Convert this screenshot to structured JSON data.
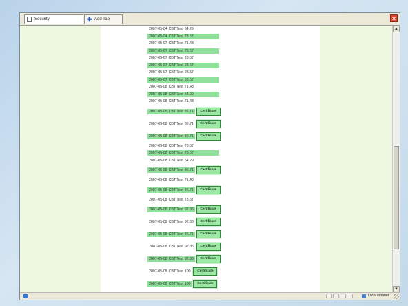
{
  "tabs": {
    "first_label": "Security",
    "add_label": "Add Tab"
  },
  "rows": [
    {
      "date": "2007-05-04",
      "test": "CBT Test",
      "score": "64.29",
      "highlight": false,
      "bar": false,
      "certificate": false
    },
    {
      "date": "2007-05-04",
      "test": "CBT Test",
      "score": "78.57",
      "highlight": true,
      "bar": true,
      "certificate": false
    },
    {
      "date": "2007-05-07",
      "test": "CBT Test",
      "score": "71.43",
      "highlight": false,
      "bar": false,
      "certificate": false
    },
    {
      "date": "2007-05-07",
      "test": "CBT Test",
      "score": "78.57",
      "highlight": true,
      "bar": true,
      "certificate": false
    },
    {
      "date": "2007-05-07",
      "test": "CBT Test",
      "score": "28.57",
      "highlight": false,
      "bar": false,
      "certificate": false
    },
    {
      "date": "2007-05-07",
      "test": "CBT Test",
      "score": "28.57",
      "highlight": true,
      "bar": true,
      "certificate": false
    },
    {
      "date": "2007-05-07",
      "test": "CBT Test",
      "score": "28.57",
      "highlight": false,
      "bar": false,
      "certificate": false
    },
    {
      "date": "2007-05-07",
      "test": "CBT Test",
      "score": "28.57",
      "highlight": true,
      "bar": true,
      "certificate": false
    },
    {
      "date": "2007-05-08",
      "test": "CBT Test",
      "score": "71.43",
      "highlight": false,
      "bar": false,
      "certificate": false
    },
    {
      "date": "2007-05-08",
      "test": "CBT Test",
      "score": "64.29",
      "highlight": true,
      "bar": true,
      "certificate": false
    },
    {
      "date": "2007-05-08",
      "test": "CBT Test",
      "score": "71.43",
      "highlight": false,
      "bar": false,
      "certificate": false
    },
    {
      "date": "2007-05-08",
      "test": "CBT Test",
      "score": "85.71",
      "highlight": true,
      "bar": false,
      "certificate": true
    },
    {
      "date": "2007-05-08",
      "test": "CBT Test",
      "score": "85.71",
      "highlight": false,
      "bar": false,
      "certificate": true
    },
    {
      "date": "2007-05-08",
      "test": "CBT Test",
      "score": "85.71",
      "highlight": true,
      "bar": false,
      "certificate": true
    },
    {
      "date": "2007-05-08",
      "test": "CBT Test",
      "score": "78.57",
      "highlight": false,
      "bar": false,
      "certificate": false
    },
    {
      "date": "2007-05-08",
      "test": "CBT Test",
      "score": "78.57",
      "highlight": true,
      "bar": true,
      "certificate": false
    },
    {
      "date": "2007-05-08",
      "test": "CBT Test",
      "score": "64.29",
      "highlight": false,
      "bar": false,
      "certificate": false
    },
    {
      "date": "2007-05-08",
      "test": "CBT Test",
      "score": "85.71",
      "highlight": true,
      "bar": false,
      "certificate": true
    },
    {
      "date": "2007-05-08",
      "test": "CBT Test",
      "score": "71.43",
      "highlight": false,
      "bar": false,
      "certificate": false
    },
    {
      "date": "2007-05-08",
      "test": "CBT Test",
      "score": "85.71",
      "highlight": true,
      "bar": false,
      "certificate": true
    },
    {
      "date": "2007-05-08",
      "test": "CBT Test",
      "score": "78.57",
      "highlight": false,
      "bar": false,
      "certificate": false
    },
    {
      "date": "2007-05-08",
      "test": "CBT Test",
      "score": "92.86",
      "highlight": true,
      "bar": false,
      "certificate": true
    },
    {
      "date": "2007-05-08",
      "test": "CBT Test",
      "score": "92.86",
      "highlight": false,
      "bar": false,
      "certificate": true
    },
    {
      "date": "2007-05-08",
      "test": "CBT Test",
      "score": "85.71",
      "highlight": true,
      "bar": false,
      "certificate": true
    },
    {
      "date": "2007-05-08",
      "test": "CBT Test",
      "score": "92.86",
      "highlight": false,
      "bar": false,
      "certificate": true
    },
    {
      "date": "2007-05-08",
      "test": "CBT Test",
      "score": "92.86",
      "highlight": true,
      "bar": false,
      "certificate": true
    },
    {
      "date": "2007-05-08",
      "test": "CBT Test",
      "score": "100",
      "highlight": false,
      "bar": false,
      "certificate": true
    },
    {
      "date": "2007-05-09",
      "test": "CBT Test",
      "score": "100",
      "highlight": true,
      "bar": false,
      "certificate": true
    }
  ],
  "certificate_label": "Certificate",
  "status": {
    "zone_text": "Local intranet"
  },
  "icons": {
    "close": "close-icon",
    "add_tab": "plus-icon",
    "page": "page-icon",
    "globe": "globe-icon",
    "zone": "intranet-zone-icon"
  },
  "colors": {
    "highlight": "#8fe09a",
    "side_band": "#eef7df",
    "certificate_bg": "#9de7a5",
    "certificate_border": "#2e8a3a",
    "desktop": "#c4dae9"
  }
}
